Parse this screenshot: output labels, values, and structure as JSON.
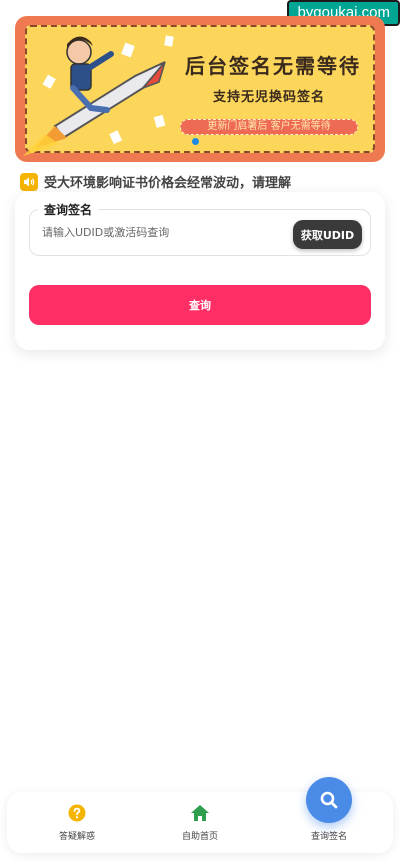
{
  "watermark": "bygoukai.com",
  "banner": {
    "title": "后台签名无需等待",
    "subtitle": "支持无児换码签名",
    "pill": "更新门启署后 客户无需等待",
    "active_dot": 0
  },
  "notice": {
    "icon": "speaker-icon",
    "text": "受大环境影响证书价格会经常波动，请理解"
  },
  "query": {
    "legend": "查询签名",
    "input_placeholder": "请输入UDID或激活码查询",
    "input_value": "",
    "get_udid_label": "获取UDID",
    "submit_label": "查询"
  },
  "nav": {
    "items": [
      {
        "label": "答疑解惑",
        "icon": "question-icon",
        "color": "#f5b400"
      },
      {
        "label": "自助首页",
        "icon": "home-icon",
        "color": "#2e9e4f"
      },
      {
        "label": "查询签名",
        "icon": "search-icon",
        "color": "#4a8be8"
      }
    ]
  },
  "colors": {
    "accent": "#ff2f66",
    "banner_bg": "#ef7a52",
    "banner_inner": "#fcd65a",
    "fab": "#4a8be8",
    "dark_button": "#3a3a3a"
  }
}
